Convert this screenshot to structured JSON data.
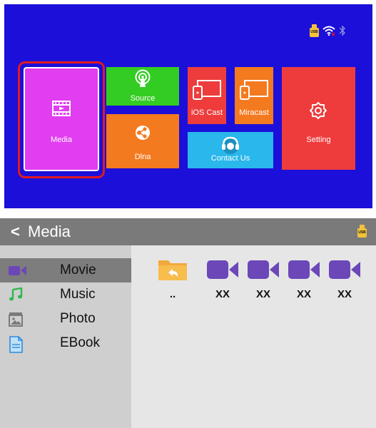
{
  "launcher": {
    "status": {
      "usb_text": "USB",
      "icons": [
        "usb-icon",
        "wifi-icon",
        "bluetooth-icon"
      ]
    },
    "tiles": {
      "media": "Media",
      "source": "Source",
      "dlna": "Dlna",
      "ios_cast": "iOS Cast",
      "miracast": "Miracast",
      "contact_us": "Contact Us",
      "setting": "Setting"
    },
    "colors": {
      "background": "#1b0fd9",
      "media": "#e03ef0",
      "source": "#33cc22",
      "dlna": "#f47a1f",
      "ios_cast": "#ee3c3c",
      "miracast": "#f47a1f",
      "contact_us": "#29b7ec",
      "setting": "#ee3c3c",
      "selection": "#e3181f"
    }
  },
  "browser": {
    "back_glyph": "<",
    "title": "Media",
    "usb_text": "USB",
    "categories": [
      {
        "label": "Movie",
        "icon": "movie-icon",
        "active": true
      },
      {
        "label": "Music",
        "icon": "music-icon",
        "active": false
      },
      {
        "label": "Photo",
        "icon": "photo-icon",
        "active": false
      },
      {
        "label": "EBook",
        "icon": "ebook-icon",
        "active": false
      }
    ],
    "files": [
      {
        "name": "..",
        "icon": "folder-up-icon"
      },
      {
        "name": "XX",
        "icon": "video-file-icon"
      },
      {
        "name": "XX",
        "icon": "video-file-icon"
      },
      {
        "name": "XX",
        "icon": "video-file-icon"
      },
      {
        "name": "XX",
        "icon": "video-file-icon"
      }
    ]
  }
}
